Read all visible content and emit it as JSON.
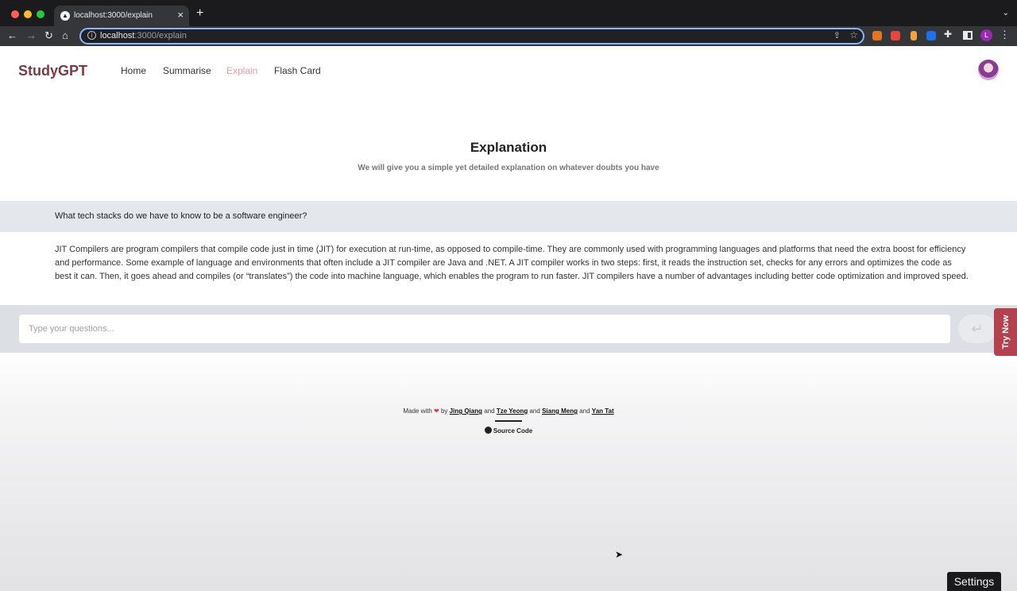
{
  "browser": {
    "tab_title": "localhost:3000/explain",
    "url_host": "localhost",
    "url_path": ":3000/explain",
    "favicon": "▲"
  },
  "nav": {
    "brand": "StudyGPT",
    "links": [
      "Home",
      "Summarise",
      "Explain",
      "Flash Card"
    ],
    "active": "Explain"
  },
  "main": {
    "title": "Explanation",
    "subtitle": "We will give you a simple yet detailed explanation on whatever doubts you have",
    "question": "What tech stacks do we have to know to be a software engineer?",
    "answer": "JIT Compilers are program compilers that compile code just in time (JIT) for execution at run-time, as opposed to compile-time. They are commonly used with programming languages and platforms that need the extra boost for efficiency and performance. Some example of language and environments that often include a JIT compiler are Java and .NET. A JIT compiler works in two steps: first, it reads the instruction set, checks for any errors and optimizes the code as best it can. Then, it goes ahead and compiles (or “translates”) the code into machine language, which enables the program to run faster. JIT compilers have a number of advantages including better code optimization and improved speed.",
    "input_placeholder": "Type your questions...",
    "try_now": "Try Now"
  },
  "footer": {
    "made_with": "Made with",
    "by": "by",
    "and": "and",
    "authors": [
      "Jing Qiang",
      "Tze Yeong",
      "Siang Meng",
      "Yan Tat"
    ],
    "source_code": "Source Code"
  },
  "overlay": {
    "settings": "Settings"
  },
  "colors": {
    "brand": "#7a3a45",
    "active_link": "#e89aa6",
    "try_now": "#b5414f",
    "question_band": "#e4e7eb"
  },
  "icons": [
    "back-arrow-icon",
    "forward-arrow-icon",
    "reload-icon",
    "home-icon",
    "info-icon",
    "share-icon",
    "star-icon",
    "puzzle-icon",
    "side-panel-icon",
    "menu-dots-icon",
    "enter-icon",
    "heart-icon",
    "github-icon",
    "cursor-icon"
  ]
}
